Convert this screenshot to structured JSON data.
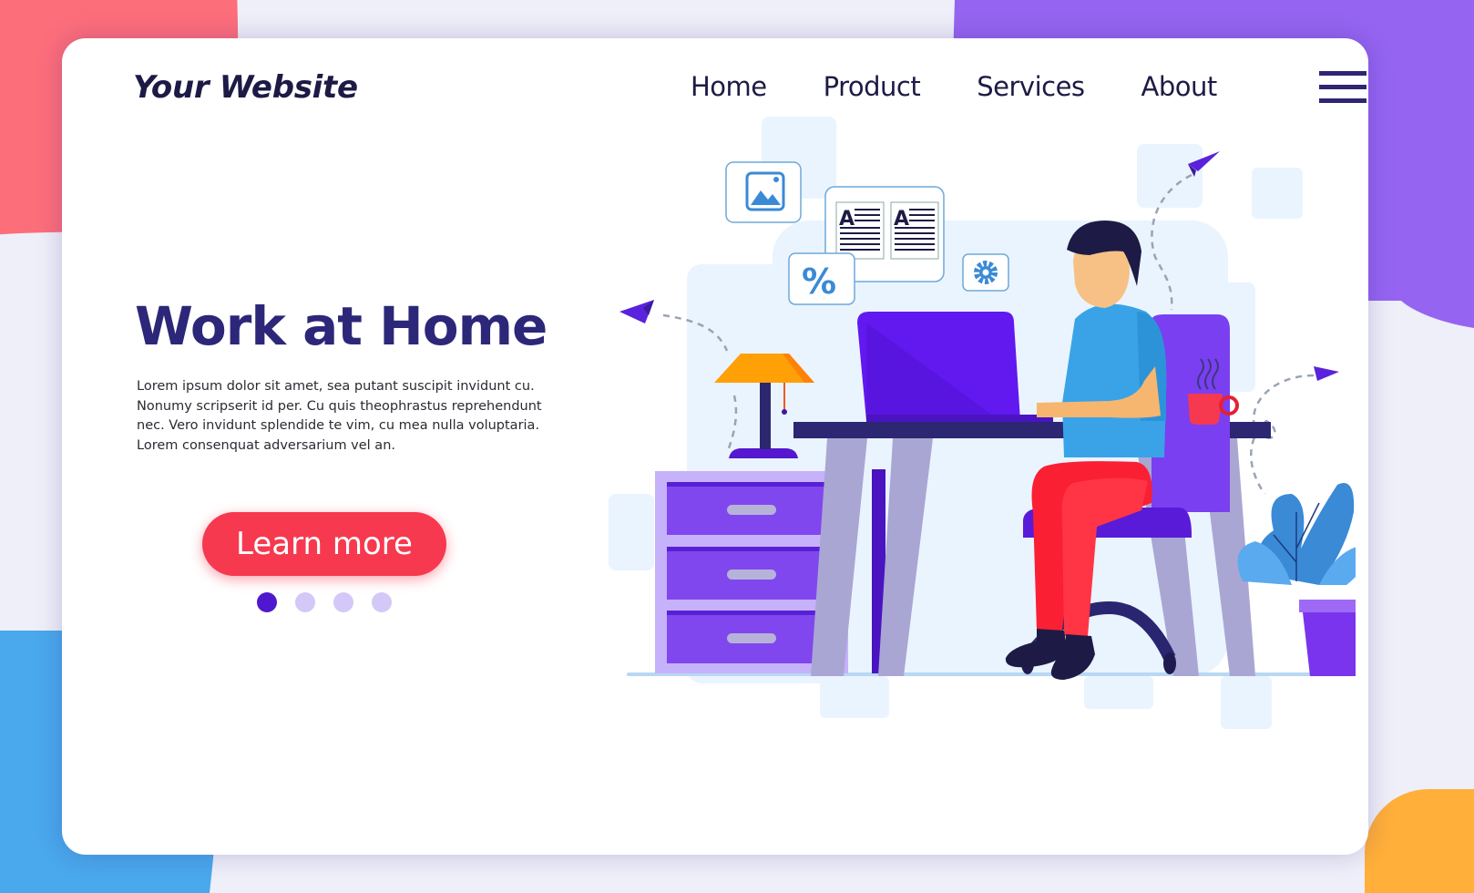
{
  "colors": {
    "brand_dark": "#1d1b45",
    "heading": "#2d2779",
    "cta": "#f6394f",
    "dot_active": "#4f18cf",
    "dot_inactive": "#d3c8f7",
    "blob_red": "#fd6e7b",
    "blob_purple": "#9565f1",
    "blob_blue": "#4aa8ec",
    "blob_orange": "#ffaf3a"
  },
  "header": {
    "logo": "Your Website",
    "nav": [
      {
        "label": "Home"
      },
      {
        "label": "Product"
      },
      {
        "label": "Services"
      },
      {
        "label": "About"
      }
    ],
    "menu_icon": "hamburger-icon"
  },
  "hero": {
    "title": "Work at Home",
    "description": "Lorem ipsum dolor sit amet, sea putant suscipit invidunt cu. Nonumy scripserit id per. Cu quis theophrastus reprehendunt nec. Vero invidunt splendide te vim, cu mea nulla voluptaria. Lorem consenquat adversarium vel an.",
    "cta_label": "Learn more",
    "carousel": {
      "total": 4,
      "active": 1
    }
  },
  "illustration": {
    "icons": [
      "image-icon",
      "document-icon",
      "percent-icon",
      "gear-icon",
      "paper-plane-icon"
    ],
    "percent_glyph": "%",
    "doc_glyph": "A"
  }
}
